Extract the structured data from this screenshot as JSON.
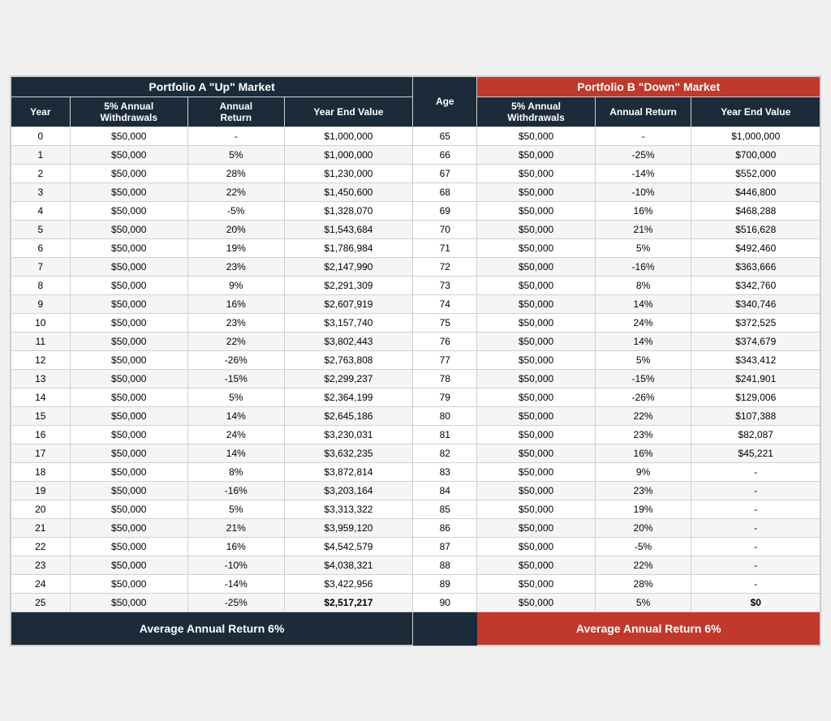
{
  "portfolioA": {
    "title": "Portfolio A \"Up\" Market",
    "columns": [
      "Year",
      "5% Annual Withdrawals",
      "Annual Return",
      "Year End Value"
    ],
    "footer": "Average Annual Return   6%"
  },
  "portfolioB": {
    "title": "Portfolio B \"Down\" Market",
    "columns": [
      "5% Annual Withdrawals",
      "Annual Return",
      "Year End Value"
    ],
    "footer": "Average Annual Return   6%"
  },
  "ageCol": "Age",
  "rows": [
    {
      "year": "0",
      "a_wd": "$50,000",
      "a_ret": "-",
      "a_yev": "$1,000,000",
      "age": "65",
      "b_wd": "$50,000",
      "b_ret": "-",
      "b_yev": "$1,000,000"
    },
    {
      "year": "1",
      "a_wd": "$50,000",
      "a_ret": "5%",
      "a_yev": "$1,000,000",
      "age": "66",
      "b_wd": "$50,000",
      "b_ret": "-25%",
      "b_yev": "$700,000"
    },
    {
      "year": "2",
      "a_wd": "$50,000",
      "a_ret": "28%",
      "a_yev": "$1,230,000",
      "age": "67",
      "b_wd": "$50,000",
      "b_ret": "-14%",
      "b_yev": "$552,000"
    },
    {
      "year": "3",
      "a_wd": "$50,000",
      "a_ret": "22%",
      "a_yev": "$1,450,600",
      "age": "68",
      "b_wd": "$50,000",
      "b_ret": "-10%",
      "b_yev": "$446,800"
    },
    {
      "year": "4",
      "a_wd": "$50,000",
      "a_ret": "-5%",
      "a_yev": "$1,328,070",
      "age": "69",
      "b_wd": "$50,000",
      "b_ret": "16%",
      "b_yev": "$468,288"
    },
    {
      "year": "5",
      "a_wd": "$50,000",
      "a_ret": "20%",
      "a_yev": "$1,543,684",
      "age": "70",
      "b_wd": "$50,000",
      "b_ret": "21%",
      "b_yev": "$516,628"
    },
    {
      "year": "6",
      "a_wd": "$50,000",
      "a_ret": "19%",
      "a_yev": "$1,786,984",
      "age": "71",
      "b_wd": "$50,000",
      "b_ret": "5%",
      "b_yev": "$492,460"
    },
    {
      "year": "7",
      "a_wd": "$50,000",
      "a_ret": "23%",
      "a_yev": "$2,147,990",
      "age": "72",
      "b_wd": "$50,000",
      "b_ret": "-16%",
      "b_yev": "$363,666"
    },
    {
      "year": "8",
      "a_wd": "$50,000",
      "a_ret": "9%",
      "a_yev": "$2,291,309",
      "age": "73",
      "b_wd": "$50,000",
      "b_ret": "8%",
      "b_yev": "$342,760"
    },
    {
      "year": "9",
      "a_wd": "$50,000",
      "a_ret": "16%",
      "a_yev": "$2,607,919",
      "age": "74",
      "b_wd": "$50,000",
      "b_ret": "14%",
      "b_yev": "$340,746"
    },
    {
      "year": "10",
      "a_wd": "$50,000",
      "a_ret": "23%",
      "a_yev": "$3,157,740",
      "age": "75",
      "b_wd": "$50,000",
      "b_ret": "24%",
      "b_yev": "$372,525"
    },
    {
      "year": "11",
      "a_wd": "$50,000",
      "a_ret": "22%",
      "a_yev": "$3,802,443",
      "age": "76",
      "b_wd": "$50,000",
      "b_ret": "14%",
      "b_yev": "$374,679"
    },
    {
      "year": "12",
      "a_wd": "$50,000",
      "a_ret": "-26%",
      "a_yev": "$2,763,808",
      "age": "77",
      "b_wd": "$50,000",
      "b_ret": "5%",
      "b_yev": "$343,412"
    },
    {
      "year": "13",
      "a_wd": "$50,000",
      "a_ret": "-15%",
      "a_yev": "$2,299,237",
      "age": "78",
      "b_wd": "$50,000",
      "b_ret": "-15%",
      "b_yev": "$241,901"
    },
    {
      "year": "14",
      "a_wd": "$50,000",
      "a_ret": "5%",
      "a_yev": "$2,364,199",
      "age": "79",
      "b_wd": "$50,000",
      "b_ret": "-26%",
      "b_yev": "$129,006"
    },
    {
      "year": "15",
      "a_wd": "$50,000",
      "a_ret": "14%",
      "a_yev": "$2,645,186",
      "age": "80",
      "b_wd": "$50,000",
      "b_ret": "22%",
      "b_yev": "$107,388"
    },
    {
      "year": "16",
      "a_wd": "$50,000",
      "a_ret": "24%",
      "a_yev": "$3,230,031",
      "age": "81",
      "b_wd": "$50,000",
      "b_ret": "23%",
      "b_yev": "$82,087"
    },
    {
      "year": "17",
      "a_wd": "$50,000",
      "a_ret": "14%",
      "a_yev": "$3,632,235",
      "age": "82",
      "b_wd": "$50,000",
      "b_ret": "16%",
      "b_yev": "$45,221"
    },
    {
      "year": "18",
      "a_wd": "$50,000",
      "a_ret": "8%",
      "a_yev": "$3,872,814",
      "age": "83",
      "b_wd": "$50,000",
      "b_ret": "9%",
      "b_yev": "-"
    },
    {
      "year": "19",
      "a_wd": "$50,000",
      "a_ret": "-16%",
      "a_yev": "$3,203,164",
      "age": "84",
      "b_wd": "$50,000",
      "b_ret": "23%",
      "b_yev": "-"
    },
    {
      "year": "20",
      "a_wd": "$50,000",
      "a_ret": "5%",
      "a_yev": "$3,313,322",
      "age": "85",
      "b_wd": "$50,000",
      "b_ret": "19%",
      "b_yev": "-"
    },
    {
      "year": "21",
      "a_wd": "$50,000",
      "a_ret": "21%",
      "a_yev": "$3,959,120",
      "age": "86",
      "b_wd": "$50,000",
      "b_ret": "20%",
      "b_yev": "-"
    },
    {
      "year": "22",
      "a_wd": "$50,000",
      "a_ret": "16%",
      "a_yev": "$4,542,579",
      "age": "87",
      "b_wd": "$50,000",
      "b_ret": "-5%",
      "b_yev": "-"
    },
    {
      "year": "23",
      "a_wd": "$50,000",
      "a_ret": "-10%",
      "a_yev": "$4,038,321",
      "age": "88",
      "b_wd": "$50,000",
      "b_ret": "22%",
      "b_yev": "-"
    },
    {
      "year": "24",
      "a_wd": "$50,000",
      "a_ret": "-14%",
      "a_yev": "$3,422,956",
      "age": "89",
      "b_wd": "$50,000",
      "b_ret": "28%",
      "b_yev": "-"
    },
    {
      "year": "25",
      "a_wd": "$50,000",
      "a_ret": "-25%",
      "a_yev": "$2,517,217",
      "age": "90",
      "b_wd": "$50,000",
      "b_ret": "5%",
      "b_yev": "$0",
      "a_bold": true,
      "b_bold": true
    }
  ]
}
